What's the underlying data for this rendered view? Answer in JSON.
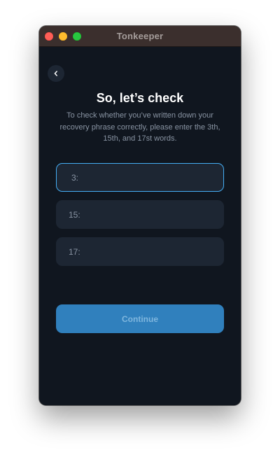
{
  "window": {
    "title": "Tonkeeper"
  },
  "header": {
    "back_icon": "chevron-left-icon"
  },
  "page": {
    "title": "So, let’s check",
    "subtitle": "To check whether you’ve written down your recovery phrase correctly, please enter the 3th, 15th, and  17st words."
  },
  "fields": [
    {
      "label": "3:",
      "value": "",
      "focused": true
    },
    {
      "label": "15:",
      "value": "",
      "focused": false
    },
    {
      "label": "17:",
      "value": "",
      "focused": false
    }
  ],
  "actions": {
    "continue_label": "Continue"
  },
  "colors": {
    "background": "#10161f",
    "field_background": "#1d2633",
    "accent": "#45aef5",
    "button_background": "#3080bd",
    "button_text": "#7fb6de",
    "secondary_text": "#8994a3"
  }
}
